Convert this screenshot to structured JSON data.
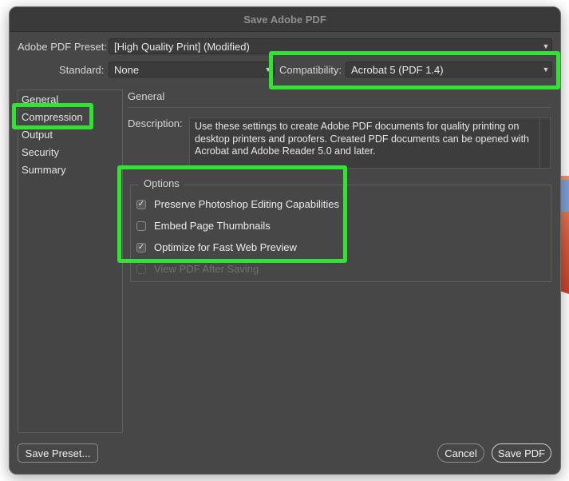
{
  "dialog": {
    "title": "Save Adobe PDF"
  },
  "preset": {
    "label": "Adobe PDF Preset:",
    "value": "[High Quality Print] (Modified)"
  },
  "standard": {
    "label": "Standard:",
    "value": "None"
  },
  "compatibility": {
    "label": "Compatibility:",
    "value": "Acrobat 5 (PDF 1.4)"
  },
  "sidebar": {
    "items": [
      {
        "label": "General"
      },
      {
        "label": "Compression"
      },
      {
        "label": "Output"
      },
      {
        "label": "Security"
      },
      {
        "label": "Summary"
      }
    ]
  },
  "panel": {
    "title": "General",
    "description_label": "Description:",
    "description": "Use these settings to create Adobe PDF documents for quality printing on desktop printers and proofers.  Created PDF documents can be opened with Acrobat and Adobe Reader 5.0 and later."
  },
  "options": {
    "legend": "Options",
    "items": [
      {
        "label": "Preserve Photoshop Editing Capabilities",
        "checked": true
      },
      {
        "label": "Embed Page Thumbnails",
        "checked": false
      },
      {
        "label": "Optimize for Fast Web Preview",
        "checked": true
      },
      {
        "label": "View PDF After Saving",
        "checked": false,
        "disabled": true
      }
    ]
  },
  "buttons": {
    "save_preset": "Save Preset...",
    "cancel": "Cancel",
    "save_pdf": "Save PDF"
  },
  "icons": {
    "chevron": "chevron-down-icon",
    "check": "checkmark-icon"
  },
  "colors": {
    "highlight": "#33e333",
    "dialog_bg": "#474747"
  }
}
